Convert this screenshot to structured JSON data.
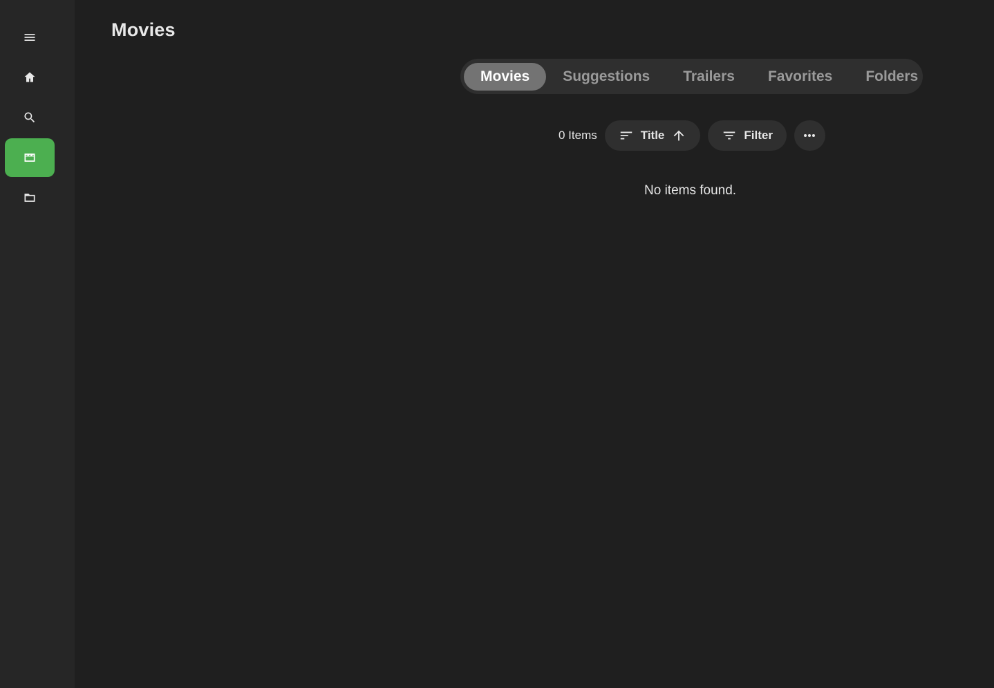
{
  "page": {
    "title": "Movies"
  },
  "sidebar": {
    "items": [
      {
        "icon": "menu-icon",
        "active": false
      },
      {
        "icon": "home-icon",
        "active": false
      },
      {
        "icon": "search-icon",
        "active": false
      },
      {
        "icon": "movie-icon",
        "active": true
      },
      {
        "icon": "folder-icon",
        "active": false
      }
    ],
    "accent_color": "#4caf50"
  },
  "tabs": [
    {
      "label": "Movies",
      "active": true
    },
    {
      "label": "Suggestions",
      "active": false
    },
    {
      "label": "Trailers",
      "active": false
    },
    {
      "label": "Favorites",
      "active": false
    },
    {
      "label": "Folders",
      "active": false
    }
  ],
  "toolbar": {
    "item_count": "0 Items",
    "sort_label": "Title",
    "sort_direction": "ascending",
    "filter_label": "Filter"
  },
  "empty_state": {
    "message": "No items found."
  }
}
